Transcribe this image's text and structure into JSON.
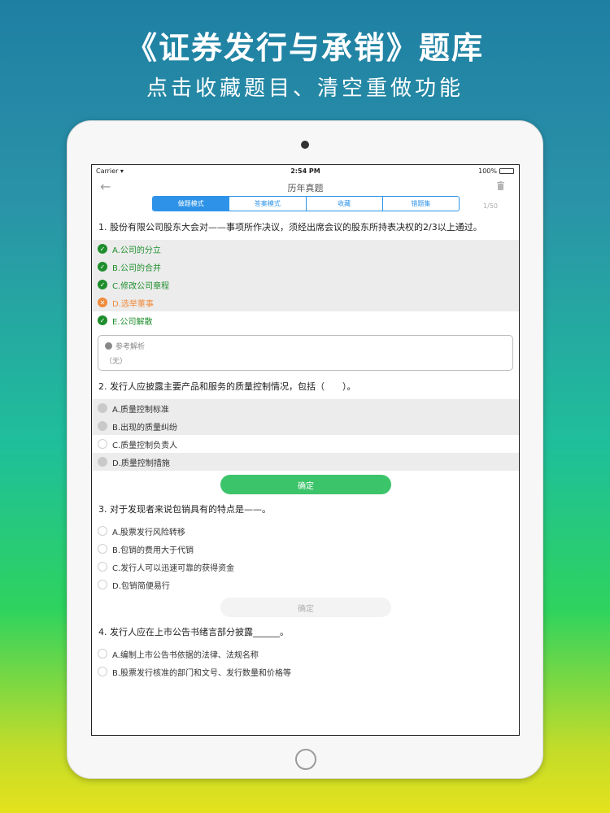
{
  "promo": {
    "headline": "《证券发行与承销》题库",
    "subline": "点击收藏题目、清空重做功能"
  },
  "status_bar": {
    "carrier": "Carrier",
    "time": "2:54 PM",
    "battery": "100%"
  },
  "nav": {
    "title": "历年真题",
    "back_icon": "arrow-left-icon",
    "trash_icon": "trash-icon"
  },
  "tabs": [
    {
      "label": "做题模式",
      "active": true
    },
    {
      "label": "答案模式",
      "active": false
    },
    {
      "label": "收藏",
      "active": false
    },
    {
      "label": "错题集",
      "active": false
    }
  ],
  "counter": "1/50",
  "questions": [
    {
      "text": "1. 股份有限公司股东大会对——事项所作决议，须经出席会议的股东所持表决权的2/3以上通过。",
      "options": [
        {
          "label": "A.公司的分立",
          "state": "correct"
        },
        {
          "label": "B.公司的合并",
          "state": "correct"
        },
        {
          "label": "C.修改公司章程",
          "state": "correct"
        },
        {
          "label": "D.选举董事",
          "state": "wrong"
        },
        {
          "label": "E.公司解散",
          "state": "correct"
        }
      ],
      "analysis": {
        "title": "参考解析",
        "body": "（无）"
      }
    },
    {
      "text": "2. 发行人应披露主要产品和服务的质量控制情况，包括（　　）。",
      "options": [
        {
          "label": "A.质量控制标准",
          "state": "selected"
        },
        {
          "label": "B.出现的质量纠纷",
          "state": "selected"
        },
        {
          "label": "C.质量控制负责人",
          "state": "empty"
        },
        {
          "label": "D.质量控制措施",
          "state": "selected"
        }
      ],
      "confirm": "确定"
    },
    {
      "text": "3. 对于发现者来说包销具有的特点是——。",
      "options": [
        {
          "label": "A.股票发行风险转移",
          "state": "empty"
        },
        {
          "label": "B.包销的费用大于代销",
          "state": "empty"
        },
        {
          "label": "C.发行人可以迅速可靠的获得资金",
          "state": "empty"
        },
        {
          "label": "D.包销简便易行",
          "state": "empty"
        }
      ],
      "confirm": "确定"
    },
    {
      "text": "4. 发行人应在上市公告书绪言部分披露______。",
      "options": [
        {
          "label": "A.编制上市公告书依据的法律、法规名称",
          "state": "empty"
        },
        {
          "label": "B.股票发行核准的部门和文号、发行数量和价格等",
          "state": "empty"
        }
      ]
    }
  ],
  "colors": {
    "accent": "#2e93e8",
    "correct": "#1e8e2c",
    "wrong": "#f08a3c",
    "confirm": "#3cc46a"
  }
}
